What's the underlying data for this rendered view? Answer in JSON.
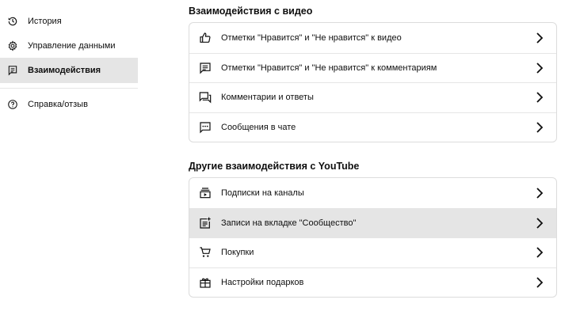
{
  "sidebar": {
    "items": [
      {
        "label": "История",
        "icon": "history-icon"
      },
      {
        "label": "Управление данными",
        "icon": "gear-icon"
      },
      {
        "label": "Взаимодействия",
        "icon": "comment-icon",
        "active": true
      },
      {
        "label": "Справка/отзыв",
        "icon": "help-icon"
      }
    ]
  },
  "sections": [
    {
      "title": "Взаимодействия с видео",
      "rows": [
        {
          "label": "Отметки \"Нравится\" и \"Не нравится\" к видео",
          "icon": "thumb-up-icon"
        },
        {
          "label": "Отметки \"Нравится\" и \"Не нравится\" к комментариям",
          "icon": "comment-icon"
        },
        {
          "label": "Комментарии и ответы",
          "icon": "comments-reply-icon"
        },
        {
          "label": "Сообщения в чате",
          "icon": "chat-icon"
        }
      ]
    },
    {
      "title": "Другие взаимодействия с YouTube",
      "rows": [
        {
          "label": "Подписки на каналы",
          "icon": "subscriptions-icon"
        },
        {
          "label": "Записи на вкладке \"Сообщество\"",
          "icon": "post-add-icon"
        },
        {
          "label": "Покупки",
          "icon": "cart-icon"
        },
        {
          "label": "Настройки подарков",
          "icon": "gift-icon"
        }
      ]
    }
  ],
  "colors": {
    "active_bg": "#e5e5e5",
    "border": "#dcdcdc",
    "text": "#0f0f0f"
  }
}
